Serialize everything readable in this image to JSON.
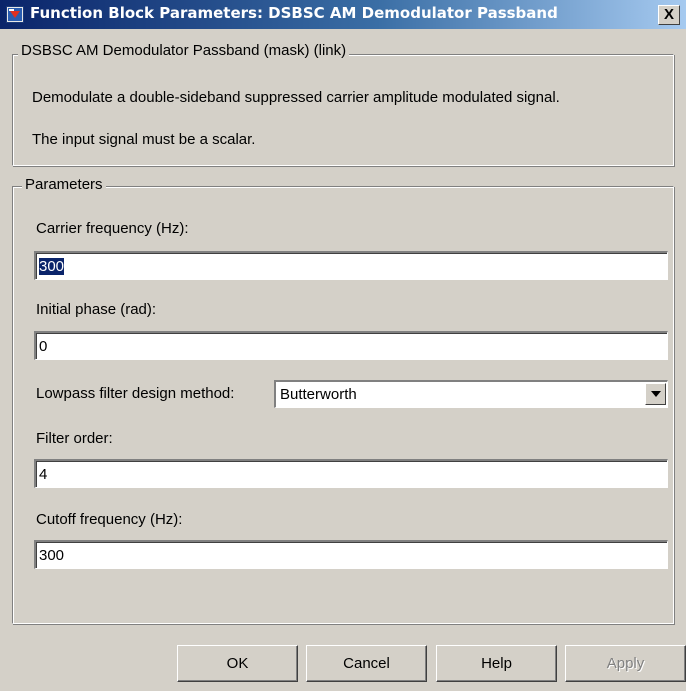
{
  "window": {
    "title": "Function Block Parameters: DSBSC AM Demodulator Passband",
    "close_label": "X"
  },
  "description_group": {
    "legend": "DSBSC AM Demodulator Passband (mask) (link)",
    "line1": "Demodulate a double-sideband suppressed carrier amplitude modulated signal.",
    "line2": "The input signal must be a scalar."
  },
  "parameters_group": {
    "legend": "Parameters",
    "carrier_frequency": {
      "label": "Carrier frequency (Hz):",
      "value": "300"
    },
    "initial_phase": {
      "label": "Initial phase (rad):",
      "value": "0"
    },
    "filter_design": {
      "label": "Lowpass filter design method:",
      "value": "Butterworth"
    },
    "filter_order": {
      "label": "Filter order:",
      "value": "4"
    },
    "cutoff_frequency": {
      "label": "Cutoff frequency (Hz):",
      "value": "300"
    }
  },
  "buttons": {
    "ok": "OK",
    "cancel": "Cancel",
    "help": "Help",
    "apply": "Apply"
  },
  "icons": {
    "title_icon": "simulink-block-icon",
    "combo_arrow": "chevron-down-icon"
  }
}
